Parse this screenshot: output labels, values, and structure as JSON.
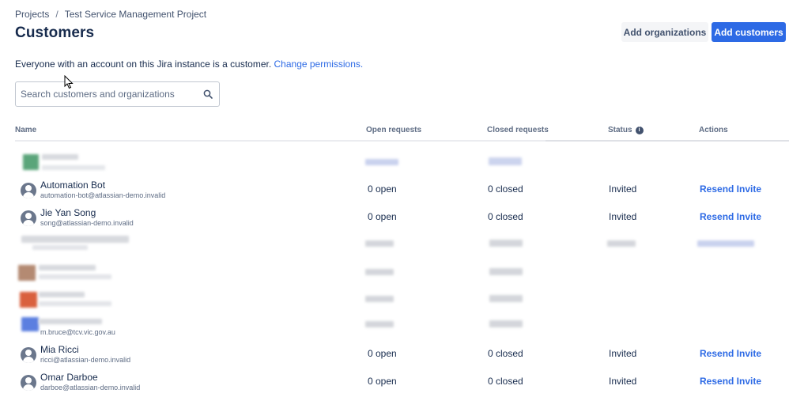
{
  "breadcrumb": {
    "projects": "Projects",
    "separator": "/",
    "project": "Test Service Management Project"
  },
  "page": {
    "title": "Customers"
  },
  "buttons": {
    "add_organizations": "Add organizations",
    "add_customers": "Add customers"
  },
  "info": {
    "text": "Everyone with an account on this Jira instance is a customer.",
    "link": "Change permissions."
  },
  "search": {
    "placeholder": "Search customers and organizations",
    "icon": "search-icon"
  },
  "table": {
    "columns": {
      "name": "Name",
      "open": "Open requests",
      "closed": "Closed requests",
      "status": "Status",
      "actions": "Actions"
    },
    "rows": [
      {
        "name": "Automation Bot",
        "email": "automation-bot@atlassian-demo.invalid",
        "open": "0 open",
        "closed": "0 closed",
        "status": "Invited",
        "action": "Resend Invite"
      },
      {
        "name": "Jie Yan Song",
        "email": "song@atlassian-demo.invalid",
        "open": "0 open",
        "closed": "0 closed",
        "status": "Invited",
        "action": "Resend Invite"
      },
      {
        "email": "m.bruce@tcv.vic.gov.au"
      },
      {
        "name": "Mia Ricci",
        "email": "ricci@atlassian-demo.invalid",
        "open": "0 open",
        "closed": "0 closed",
        "status": "Invited",
        "action": "Resend Invite"
      },
      {
        "name": "Omar Darboe",
        "email": "darboe@atlassian-demo.invalid",
        "open": "0 open",
        "closed": "0 closed",
        "status": "Invited",
        "action": "Resend Invite"
      }
    ]
  },
  "colors": {
    "primary": "#2d6ae5",
    "text": "#172b4d",
    "subtle": "#5e6c84"
  }
}
